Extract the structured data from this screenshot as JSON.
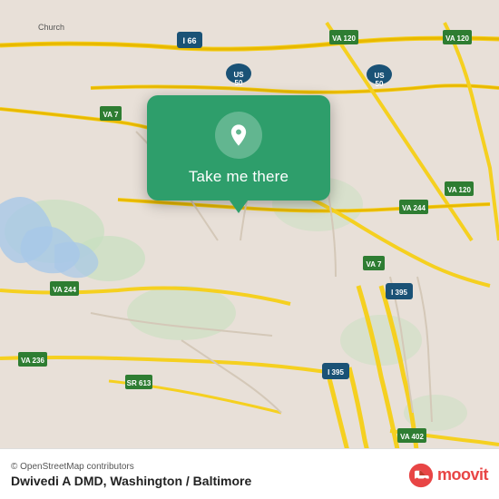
{
  "map": {
    "background_color": "#e8e0d8",
    "center_lat": 38.85,
    "center_lon": -77.12
  },
  "popup": {
    "button_label": "Take me there",
    "background_color": "#2e9e6b"
  },
  "bottom_bar": {
    "copyright": "© OpenStreetMap contributors",
    "location_name": "Dwivedi A DMD",
    "region": "Washington / Baltimore"
  },
  "moovit": {
    "text": "moovit"
  }
}
